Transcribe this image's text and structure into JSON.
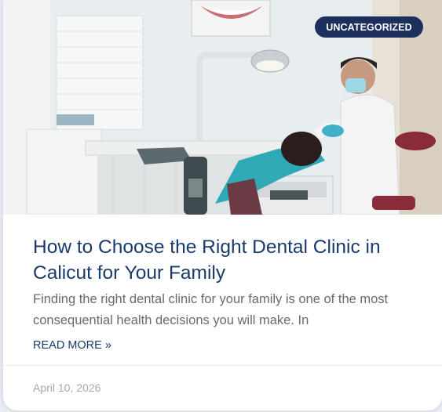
{
  "post": {
    "category": "UNCATEGORIZED",
    "title": "How to Choose the Right Dental Clinic in Calicut for Your Family",
    "excerpt": "Finding the right dental clinic for your family is one of the most consequential health decisions you will make. In",
    "read_more": "READ MORE »",
    "date": "April 10, 2026",
    "image_alt": "Dentist examining a patient in a dental clinic"
  },
  "colors": {
    "badge_bg": "#1d2f5c",
    "title": "#1a3a6b",
    "excerpt": "#6a6a6a",
    "date": "#a8a8a8"
  }
}
